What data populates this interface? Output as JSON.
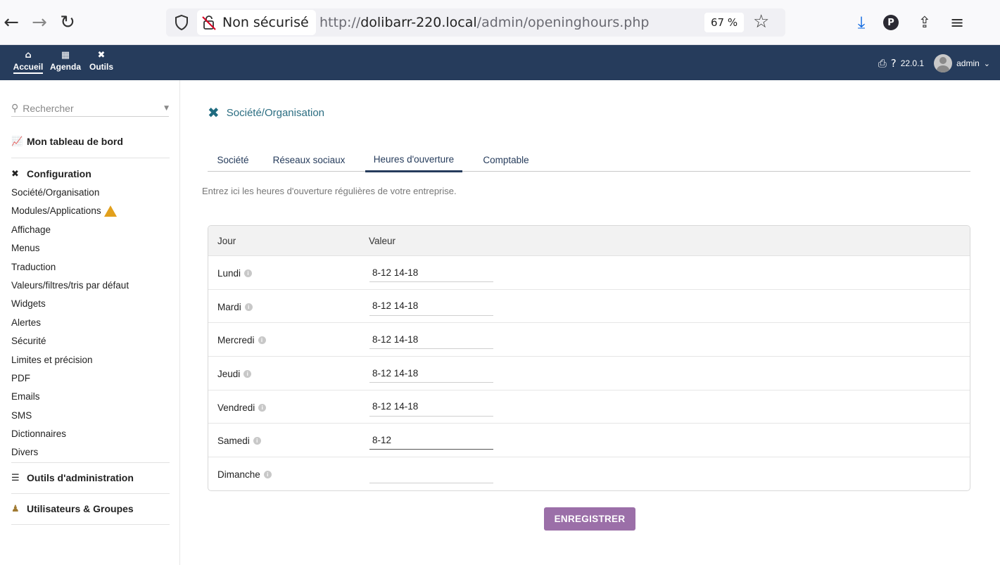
{
  "browser": {
    "security_label": "Non sécurisé",
    "url_prefix": "http://",
    "url_host": "dolibarr-220.local",
    "url_path": "/admin/openinghours.php",
    "zoom": "67 %"
  },
  "topmenu": {
    "items": [
      {
        "label": "Accueil",
        "icon": "home-icon"
      },
      {
        "label": "Agenda",
        "icon": "calendar-icon"
      },
      {
        "label": "Outils",
        "icon": "tools-icon"
      }
    ],
    "version": "22.0.1",
    "user": "admin"
  },
  "sidebar": {
    "search_placeholder": "Rechercher",
    "dashboard": "Mon tableau de bord",
    "configuration": "Configuration",
    "links": [
      "Société/Organisation",
      "Modules/Applications",
      "Affichage",
      "Menus",
      "Traduction",
      "Valeurs/filtres/tris par défaut",
      "Widgets",
      "Alertes",
      "Sécurité",
      "Limites et précision",
      "PDF",
      "Emails",
      "SMS",
      "Dictionnaires",
      "Divers"
    ],
    "admin_tools": "Outils d'administration",
    "users_groups": "Utilisateurs & Groupes"
  },
  "main": {
    "title": "Société/Organisation",
    "tabs": [
      "Société",
      "Réseaux sociaux",
      "Heures d'ouverture",
      "Comptable"
    ],
    "active_tab": "Heures d'ouverture",
    "intro": "Entrez ici les heures d'ouverture régulières de votre entreprise.",
    "table": {
      "col_day": "Jour",
      "col_value": "Valeur",
      "rows": [
        {
          "day": "Lundi",
          "value": "8-12 14-18"
        },
        {
          "day": "Mardi",
          "value": "8-12 14-18"
        },
        {
          "day": "Mercredi",
          "value": "8-12 14-18"
        },
        {
          "day": "Jeudi",
          "value": "8-12 14-18"
        },
        {
          "day": "Vendredi",
          "value": "8-12 14-18"
        },
        {
          "day": "Samedi",
          "value": "8-12"
        },
        {
          "day": "Dimanche",
          "value": ""
        }
      ]
    },
    "save_label": "ENREGISTRER"
  },
  "colors": {
    "topbar": "#263c5c",
    "title": "#2c6e82",
    "button": "#9b6fa8",
    "warning": "#e2a01c"
  }
}
